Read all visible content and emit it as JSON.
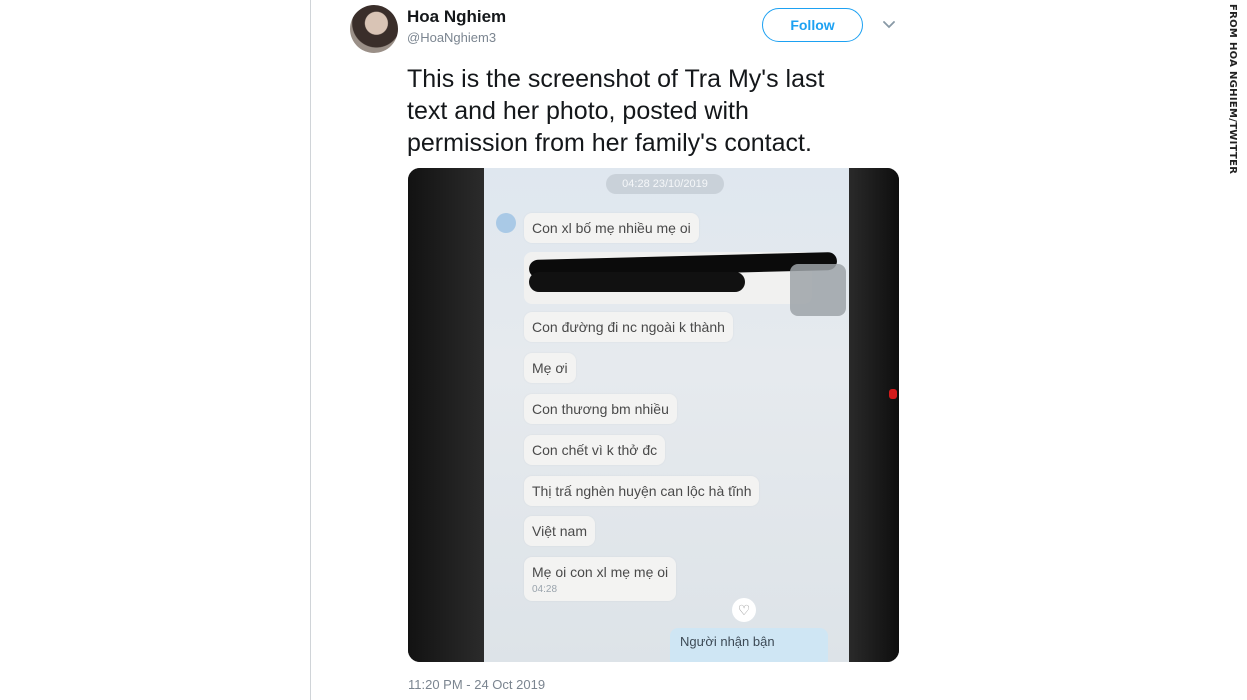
{
  "tweet": {
    "author_name": "Hoa Nghiem",
    "author_handle": "@HoaNghiem3",
    "follow_label": "Follow",
    "text_lines": [
      "This is the screenshot of Tra My's last",
      "text and her photo, posted with",
      "permission from her family's contact."
    ],
    "timestamp": "11:20 PM - 24 Oct 2019"
  },
  "photo": {
    "chat_timestamp": "04:28 23/10/2019",
    "messages": [
      "Con xl bố mẹ nhiều mẹ oi",
      "Con đường đi nc ngoài k thành",
      "Mẹ ơi",
      "Con thương bm nhiều",
      "Con chết vì k thở đc",
      "Thị trấ nghèn huyện can lộc hà tĩnh",
      "Việt nam",
      "Mẹ oi con xl mẹ mẹ oi"
    ],
    "last_message_time": "04:28",
    "reply_preview": "Người nhận bận"
  },
  "credit": "FROM HOA NGHIEM/TWITTER",
  "colors": {
    "accent": "#1da1f2",
    "secondary_text": "#7b8590"
  },
  "icons": {
    "more": "chevron-down-icon",
    "like": "heart-icon"
  }
}
